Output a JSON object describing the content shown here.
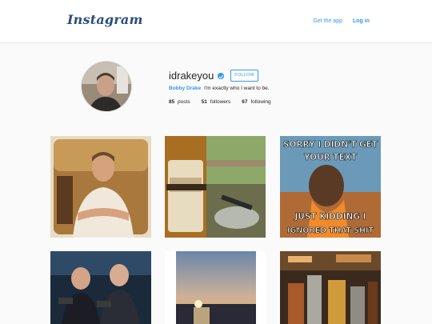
{
  "header": {
    "logo_text": "Instagram",
    "get_app_label": "Get the app",
    "login_label": "Log in"
  },
  "profile": {
    "username": "idrakeyou",
    "follow_label": "FOLLOW",
    "full_name": "Bobby Drake",
    "bio": "I'm exactly who I want to be.",
    "posts_count": "85",
    "posts_label": "posts",
    "followers_count": "51",
    "followers_label": "followers",
    "following_count": "67",
    "following_label": "following"
  },
  "posts": [
    {
      "icon": "portrait-photo"
    },
    {
      "icon": "whisky-bottle-photo"
    },
    {
      "icon": "meme-photo",
      "top_text": "SORRY I DIDN'T GET",
      "top_text2": "YOUR TEXT",
      "bottom_text": "JUST KIDDING I",
      "bottom_text2": "IGNORED THAT SHIT"
    },
    {
      "icon": "two-men-photo"
    },
    {
      "icon": "sunset-photo"
    },
    {
      "icon": "bar-photo"
    }
  ],
  "colors": {
    "accent": "#3897f0",
    "logo": "#2a4f7a"
  }
}
